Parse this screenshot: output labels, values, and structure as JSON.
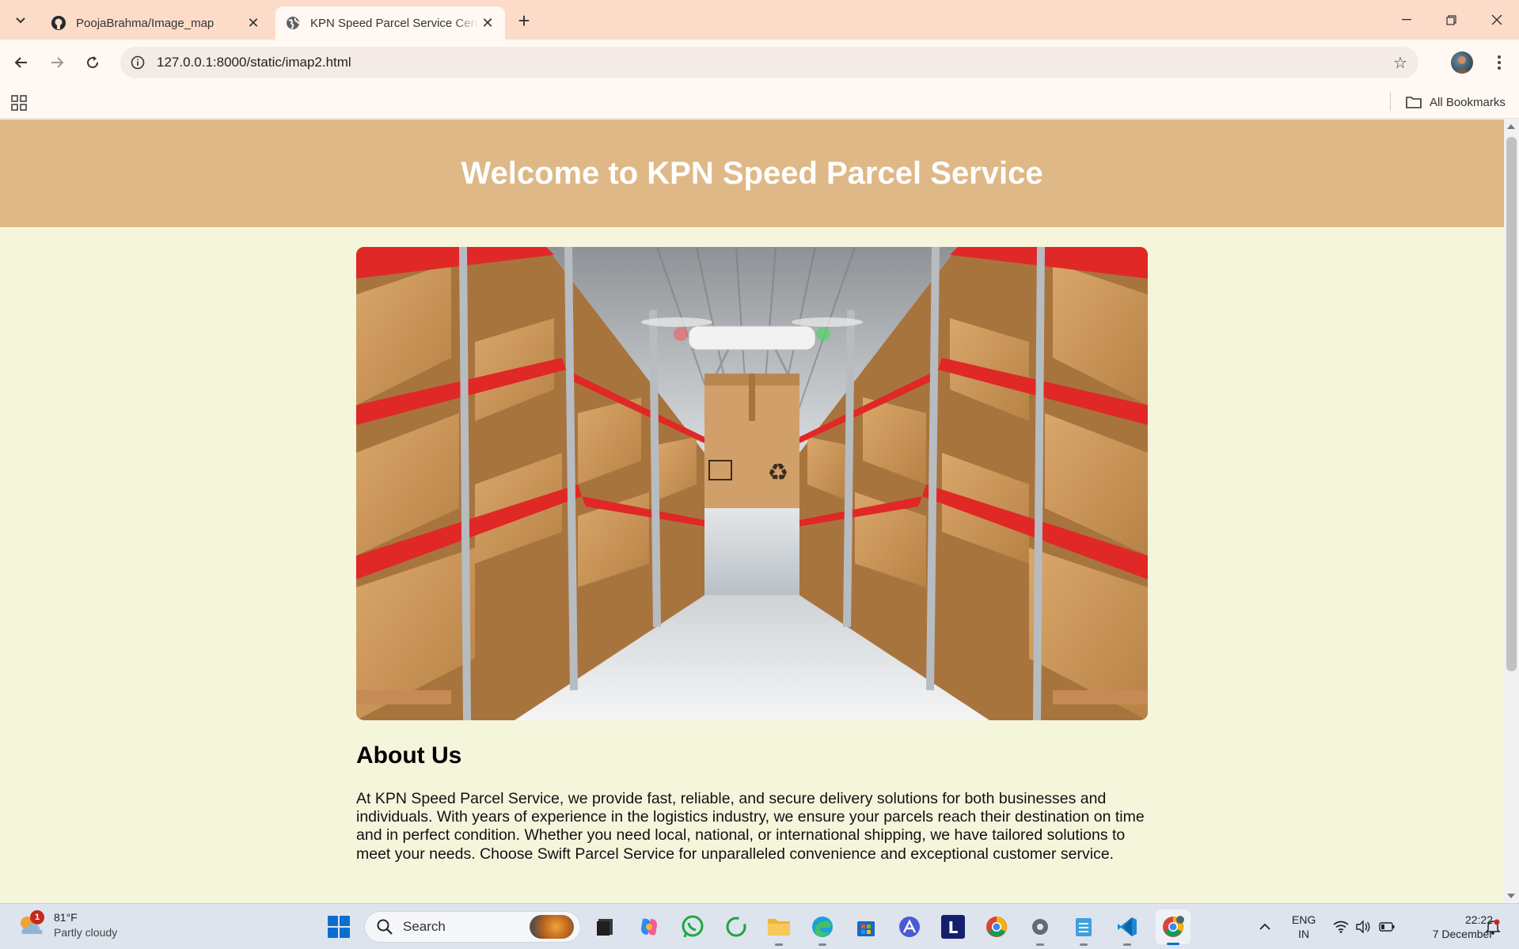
{
  "browser": {
    "tabs": [
      {
        "title": "PoojaBrahma/Image_map",
        "favicon": "github-icon",
        "active": false
      },
      {
        "title": "KPN Speed Parcel Service Cente",
        "favicon": "globe-icon",
        "active": true
      }
    ],
    "url": "127.0.0.1:8000/static/imap2.html",
    "bookmarks_label": "All Bookmarks"
  },
  "page": {
    "header_title": "Welcome to KPN Speed Parcel Service",
    "hero_alt": "Warehouse with drone delivering parcel",
    "about_title": "About Us",
    "about_text": "At KPN Speed Parcel Service, we provide fast, reliable, and secure delivery solutions for both businesses and individuals. With years of experience in the logistics industry, we ensure your parcels reach their destination on time and in perfect condition. Whether you need local, national, or international shipping, we have tailored solutions to meet your needs. Choose Swift Parcel Service for unparalleled convenience and exceptional customer service.",
    "colors": {
      "header_bg": "#deb887",
      "page_bg": "#f5f5dc",
      "header_text": "#ffffff"
    }
  },
  "taskbar": {
    "weather_temp": "81°F",
    "weather_condition": "Partly cloudy",
    "weather_badge": "1",
    "search_placeholder": "Search",
    "apps": [
      "file-explorer-icon",
      "copilot-icon",
      "whatsapp-icon",
      "refresh-app-icon",
      "folder-icon",
      "edge-icon",
      "store-icon",
      "feather-app-icon",
      "l-app-icon",
      "chrome-icon",
      "settings-icon",
      "notepad-icon",
      "vscode-icon",
      "chrome-profile-icon"
    ],
    "lang_line1": "ENG",
    "lang_line2": "IN",
    "time": "22:22",
    "date": "7 December"
  }
}
